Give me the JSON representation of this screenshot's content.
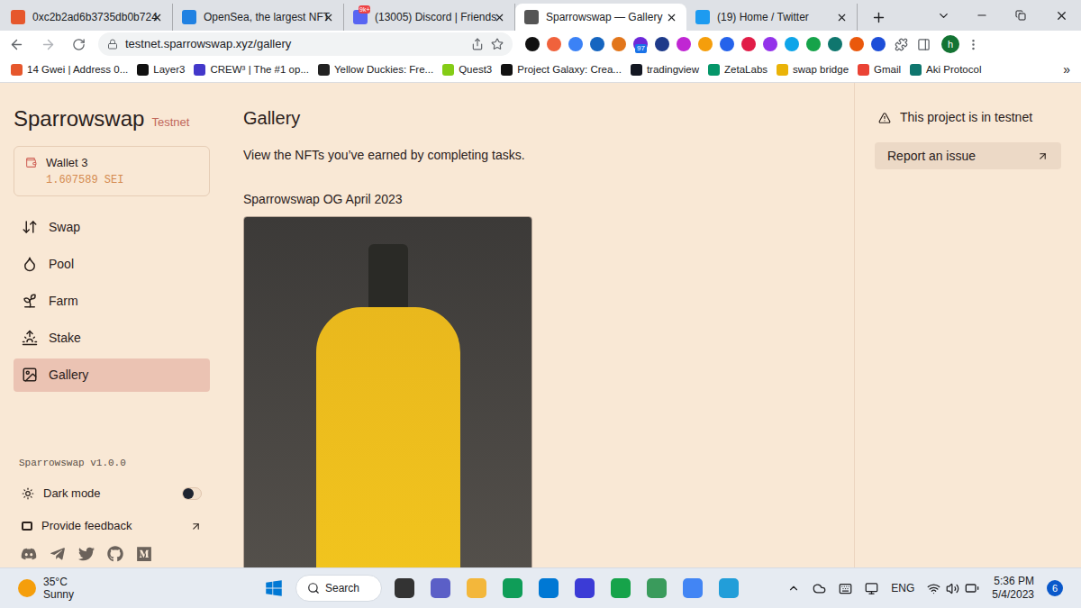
{
  "browser": {
    "tabs": [
      {
        "title": "0xc2b2ad6b3735db0b724",
        "selected": false,
        "badge": "",
        "color": "#e6572c"
      },
      {
        "title": "OpenSea, the largest NFT",
        "selected": false,
        "badge": "",
        "color": "#2081e2"
      },
      {
        "title": "(13005) Discord | Friends",
        "selected": false,
        "badge": "9k+",
        "color": "#5865f2"
      },
      {
        "title": "Sparrowswap — Gallery",
        "selected": true,
        "badge": "",
        "color": "#555555"
      },
      {
        "title": "(19) Home / Twitter",
        "selected": false,
        "badge": "",
        "color": "#1d9bf0"
      }
    ],
    "url": "testnet.sparrowswap.xyz/gallery",
    "extensions": [
      {
        "color": "#111111",
        "badge": ""
      },
      {
        "color": "#f0623c",
        "badge": ""
      },
      {
        "color": "#3b82f6",
        "badge": ""
      },
      {
        "color": "#1565c0",
        "badge": ""
      },
      {
        "color": "#e2761b",
        "badge": ""
      },
      {
        "color": "#6d28d9",
        "badge": "97"
      },
      {
        "color": "#1e3a8a",
        "badge": ""
      },
      {
        "color": "#c026d3",
        "badge": ""
      },
      {
        "color": "#f59e0b",
        "badge": ""
      },
      {
        "color": "#2563eb",
        "badge": ""
      },
      {
        "color": "#e11d48",
        "badge": ""
      },
      {
        "color": "#9333ea",
        "badge": ""
      },
      {
        "color": "#0ea5e9",
        "badge": ""
      },
      {
        "color": "#16a34a",
        "badge": ""
      },
      {
        "color": "#0f766e",
        "badge": ""
      },
      {
        "color": "#ea580c",
        "badge": ""
      },
      {
        "color": "#1d4ed8",
        "badge": ""
      }
    ],
    "avatar": "h",
    "bookmarks": [
      {
        "label": "14 Gwei | Address 0...",
        "color": "#e6572c"
      },
      {
        "label": "Layer3",
        "color": "#111111"
      },
      {
        "label": "CREW³ | The #1 op...",
        "color": "#4338ca"
      },
      {
        "label": "Yellow Duckies: Fre...",
        "color": "#222222"
      },
      {
        "label": "Quest3",
        "color": "#84cc16"
      },
      {
        "label": "Project Galaxy: Crea...",
        "color": "#111111"
      },
      {
        "label": "tradingview",
        "color": "#131722"
      },
      {
        "label": "ZetaLabs",
        "color": "#059669"
      },
      {
        "label": "swap bridge",
        "color": "#eab308"
      },
      {
        "label": "Gmail",
        "color": "#ea4335"
      },
      {
        "label": "Aki Protocol",
        "color": "#0f766e"
      }
    ],
    "bookmarks_more": "»"
  },
  "sidebar": {
    "brand": "Sparrowswap",
    "network": "Testnet",
    "wallet": {
      "name": "Wallet 3",
      "balance": "1.607589 SEI"
    },
    "items": [
      {
        "label": "Swap",
        "selected": false
      },
      {
        "label": "Pool",
        "selected": false
      },
      {
        "label": "Farm",
        "selected": false
      },
      {
        "label": "Stake",
        "selected": false
      },
      {
        "label": "Gallery",
        "selected": true
      }
    ],
    "version": "Sparrowswap v1.0.0",
    "dark_mode": {
      "label": "Dark mode",
      "on": false
    },
    "feedback": "Provide feedback"
  },
  "gallery": {
    "title": "Gallery",
    "description": "View the NFTs you’ve earned by completing tasks.",
    "nft_title": "Sparrowswap OG April 2023"
  },
  "notice": {
    "text": "This project is in testnet",
    "button": "Report an issue"
  },
  "taskbar": {
    "temperature": "35°C",
    "weather": "Sunny",
    "search": "Search",
    "apps": [
      {
        "color": "#333333"
      },
      {
        "color": "#5b5fc7"
      },
      {
        "color": "#f3b73b"
      },
      {
        "color": "#0f9d58"
      },
      {
        "color": "#0078d4"
      },
      {
        "color": "#3b3bd6"
      },
      {
        "color": "#16a34a"
      },
      {
        "color": "#3a9b5c"
      },
      {
        "color": "#4285f4"
      },
      {
        "color": "#229ed9"
      }
    ],
    "language": "ENG",
    "time": "5:36 PM",
    "date": "5/4/2023",
    "notifications": "6"
  }
}
